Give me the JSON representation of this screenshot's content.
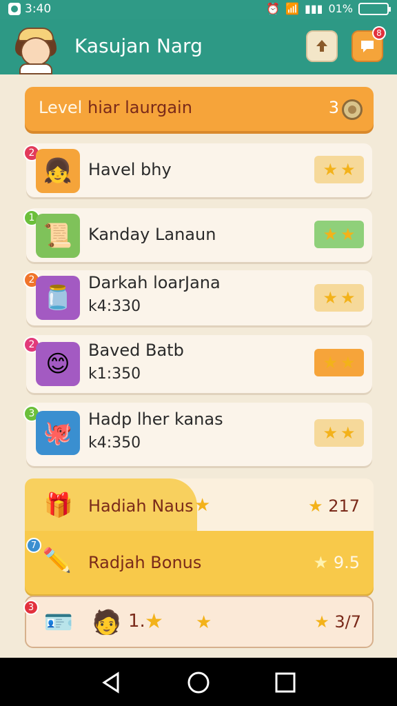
{
  "status_bar": {
    "time": "3:40",
    "battery": "01%"
  },
  "header": {
    "title": "Kasujan Narg",
    "notif_count": "8"
  },
  "level_bar": {
    "label_prefix": "Level",
    "label_rest": "hiar laurgain",
    "value": "3"
  },
  "list": [
    {
      "badge": "2",
      "badge_color": "#e23a5a",
      "thumb_color": "#f5a43a",
      "name": "Havel bhy",
      "sub": "",
      "stars_bg": "#f6d99a"
    },
    {
      "badge": "1",
      "badge_color": "#6bbf3a",
      "thumb_color": "#7fc25a",
      "name": "Kanday Lanaun",
      "sub": "",
      "stars_bg": "#8fd07a"
    },
    {
      "badge": "2",
      "badge_color": "#f0742a",
      "thumb_color": "#a35ac2",
      "name": "Darkah loarJana",
      "sub": "k4:330",
      "stars_bg": "#f6d99a"
    },
    {
      "badge": "2",
      "badge_color": "#e23a7a",
      "thumb_color": "#a35ac2",
      "name": "Baved Batb",
      "sub": "k1:350",
      "stars_bg": "#f6a43a"
    },
    {
      "badge": "3",
      "badge_color": "#6bbf3a",
      "thumb_color": "#3a8fd0",
      "name": "Hadp lher kanas",
      "sub": "k4:350",
      "stars_bg": "#f6d99a"
    }
  ],
  "rewards": [
    {
      "label": "Hadiah Naus",
      "value": "217"
    },
    {
      "label": "Radjah Bonus",
      "value": "9.5"
    }
  ],
  "last_row": {
    "badge": "3",
    "number": "1.",
    "value": "3/7"
  }
}
